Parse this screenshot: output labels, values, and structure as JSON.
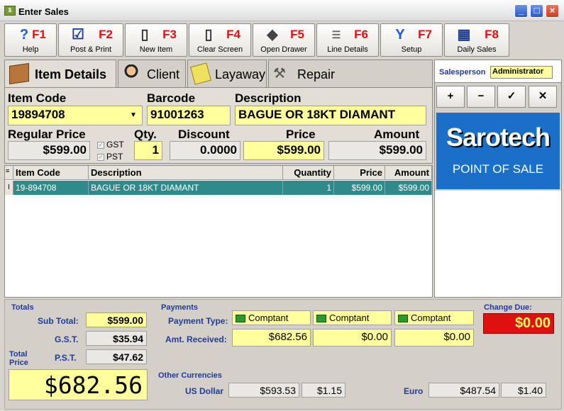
{
  "window": {
    "title": "Enter Sales"
  },
  "toolbar": [
    {
      "key": "F1",
      "label": "Help",
      "icon": "help-icon"
    },
    {
      "key": "F2",
      "label": "Post & Print",
      "icon": "post-print-icon"
    },
    {
      "key": "F3",
      "label": "New Item",
      "icon": "new-item-icon"
    },
    {
      "key": "F4",
      "label": "Clear Screen",
      "icon": "clear-screen-icon"
    },
    {
      "key": "F5",
      "label": "Open Drawer",
      "icon": "open-drawer-icon"
    },
    {
      "key": "F6",
      "label": "Line Details",
      "icon": "line-details-icon"
    },
    {
      "key": "F7",
      "label": "Setup",
      "icon": "setup-wrench-icon"
    },
    {
      "key": "F8",
      "label": "Daily Sales",
      "icon": "daily-sales-icon"
    }
  ],
  "tabs": [
    {
      "label": "Item Details",
      "icon": "box-icon",
      "active": true
    },
    {
      "label": "Client",
      "icon": "client-icon"
    },
    {
      "label": "Layaway",
      "icon": "layaway-icon"
    },
    {
      "label": "Repair",
      "icon": "hammer-icon"
    }
  ],
  "item": {
    "item_code_label": "Item Code",
    "item_code": "19894708",
    "barcode_label": "Barcode",
    "barcode": "91001263",
    "description_label": "Description",
    "description": "BAGUE OR 18KT DIAMANT",
    "regular_price_label": "Regular Price",
    "regular_price": "$599.00",
    "gst_label": "GST",
    "pst_label": "PST",
    "qty_label": "Qty.",
    "qty": "1",
    "discount_label": "Discount",
    "discount": "0.0000",
    "price_label": "Price",
    "price": "$599.00",
    "amount_label": "Amount",
    "amount": "$599.00"
  },
  "grid": {
    "columns": [
      "Item Code",
      "Description",
      "Quantity",
      "Price",
      "Amount"
    ],
    "rows": [
      [
        "19-894708",
        "BAGUE OR 18KT DIAMANT",
        "1",
        "$599.00",
        "$599.00"
      ]
    ]
  },
  "salesperson": {
    "label": "Salesperson",
    "value": "Administrator"
  },
  "actions": [
    "+",
    "−",
    "✓",
    "✕"
  ],
  "logo": {
    "brand": "Sarotech",
    "tagline": "POINT OF SALE"
  },
  "totals": {
    "header": "Totals",
    "subtotal_label": "Sub Total:",
    "subtotal": "$599.00",
    "gst_label": "G.S.T.",
    "gst": "$35.94",
    "pst_label": "P.S.T.",
    "pst": "$47.62",
    "total_price_label": "Total Price",
    "total_price": "$682.56"
  },
  "payments": {
    "header": "Payments",
    "type_label": "Payment Type:",
    "received_label": "Amt. Received:",
    "types": [
      "Comptant",
      "Comptant",
      "Comptant"
    ],
    "received": [
      "$682.56",
      "$0.00",
      "$0.00"
    ]
  },
  "change": {
    "label": "Change Due:",
    "value": "$0.00"
  },
  "currencies": {
    "header": "Other Currencies",
    "usd_label": "US Dollar",
    "usd_amount": "$593.53",
    "usd_rate": "$1.15",
    "euro_label": "Euro",
    "euro_amount": "$487.54",
    "euro_rate": "$1.40"
  }
}
